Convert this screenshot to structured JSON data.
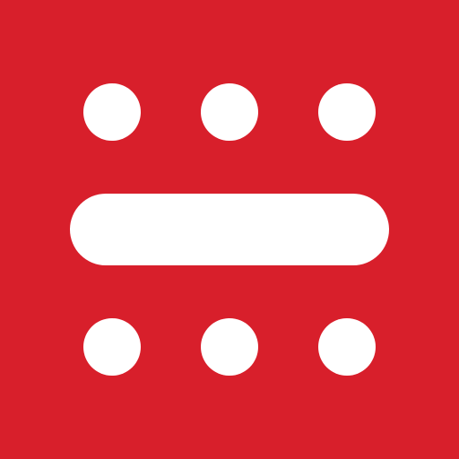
{
  "logo": {
    "icon": "dots-and-bar-logo-icon",
    "background_color": "#d81f2b",
    "foreground_color": "#ffffff"
  }
}
